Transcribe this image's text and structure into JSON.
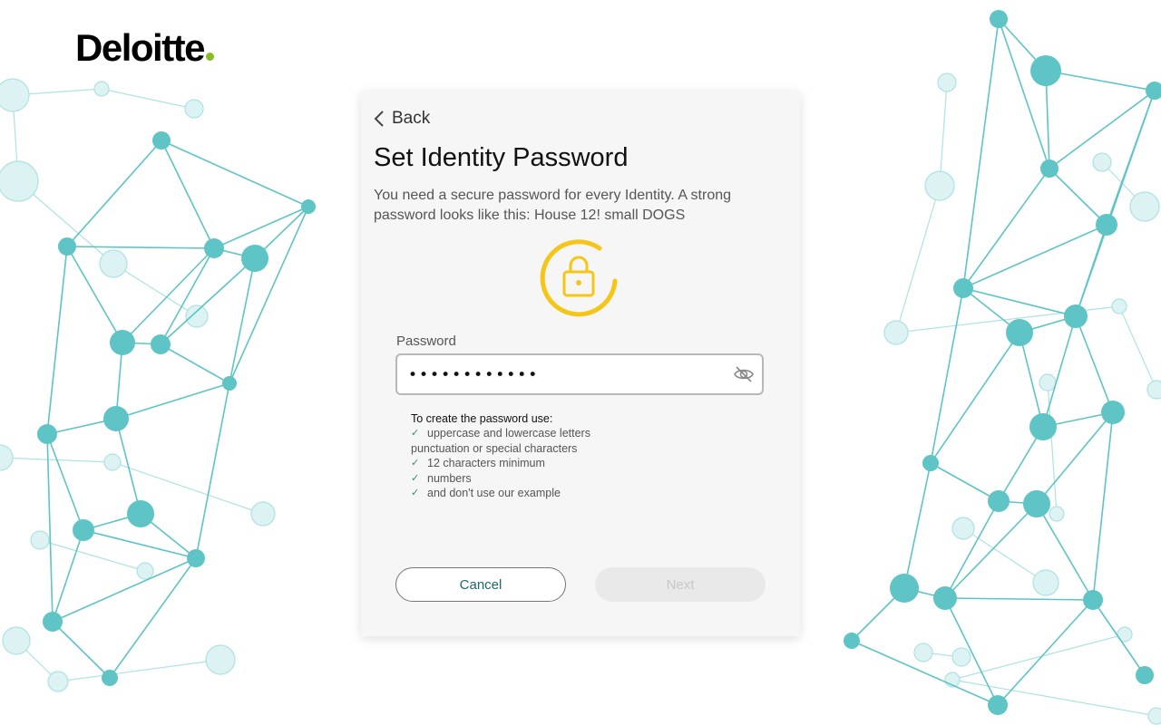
{
  "brand": {
    "name": "Deloitte",
    "dot_color": "#86bc25"
  },
  "card": {
    "back_label": "Back",
    "title": "Set Identity Password",
    "description": "You need a secure password for every Identity. A strong password looks like this:  House 12! small DOGS",
    "lock_color": "#f5c518"
  },
  "password": {
    "label": "Password",
    "value": "••••••••••••",
    "visibility_icon": "eye-slash-icon"
  },
  "requirements": {
    "heading": "To create the password use:",
    "items": [
      {
        "text": "uppercase and lowercase letters",
        "checked": true
      },
      {
        "text": "punctuation or special characters",
        "checked": false
      },
      {
        "text": "12 characters minimum",
        "checked": true
      },
      {
        "text": "numbers",
        "checked": true
      },
      {
        "text": "and don't use our example",
        "checked": true
      }
    ]
  },
  "buttons": {
    "cancel": "Cancel",
    "next": "Next",
    "next_enabled": false
  },
  "colors": {
    "network": "#5ec4c6",
    "accent_text": "#1d6a6a"
  }
}
